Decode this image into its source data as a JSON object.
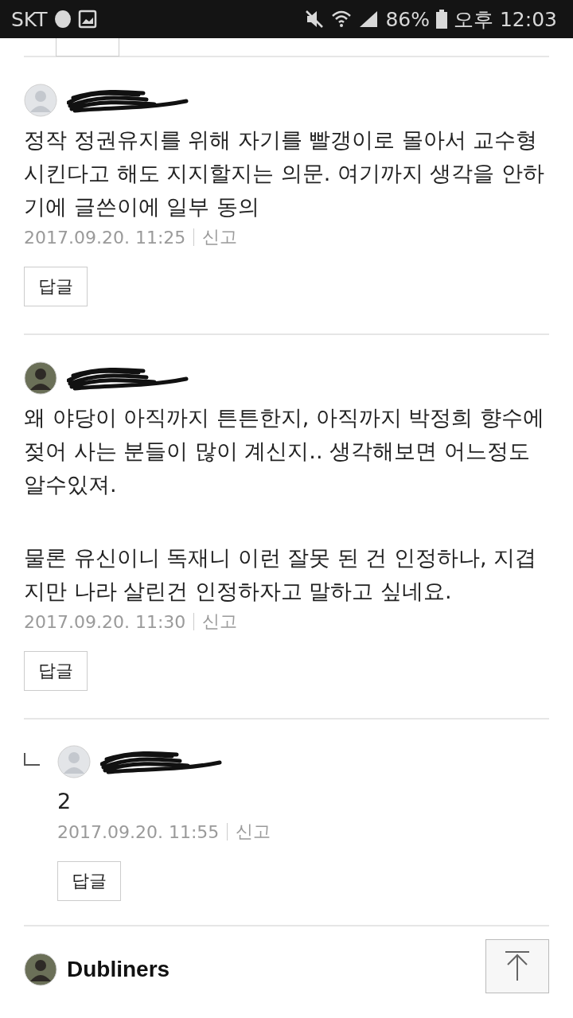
{
  "status_bar": {
    "carrier": "SKT",
    "battery": "86%",
    "ampm": "오후",
    "time": "12:03"
  },
  "comments": [
    {
      "avatar": {
        "kind": "default"
      },
      "author_hidden": true,
      "reply": false,
      "body": [
        "정작 정권유지를 위해 자기를 빨갱이로 몰아서 교수형 시킨다고 해도 지지할지는 의문. 여기까지 생각을 안하기에 글쓴이에 일부 동의"
      ],
      "date": "2017.09.20. 11:25",
      "report": "신고",
      "reply_button": "답글"
    },
    {
      "author_hidden": true,
      "reply": false,
      "body": [
        "왜 야당이 아직까지 튼튼한지, 아직까지 박정희 향수에 젖어 사는 분들이 많이 계신지.. 생각해보면 어느정도 알수있져.",
        "물론 유신이니 독재니 이런 잘못 된 건 인정하나, 지겹지만 나라 살린건 인정하자고 말하고 싶네요."
      ],
      "date": "2017.09.20. 11:30",
      "report": "신고",
      "reply_button": "답글"
    },
    {
      "avatar": {
        "kind": "default"
      },
      "author_hidden": true,
      "reply": true,
      "body": [
        "2"
      ],
      "date": "2017.09.20. 11:55",
      "report": "신고",
      "reply_button": "답글"
    },
    {
      "author": "Dubliners",
      "author_hidden": false,
      "reply": false
    }
  ]
}
